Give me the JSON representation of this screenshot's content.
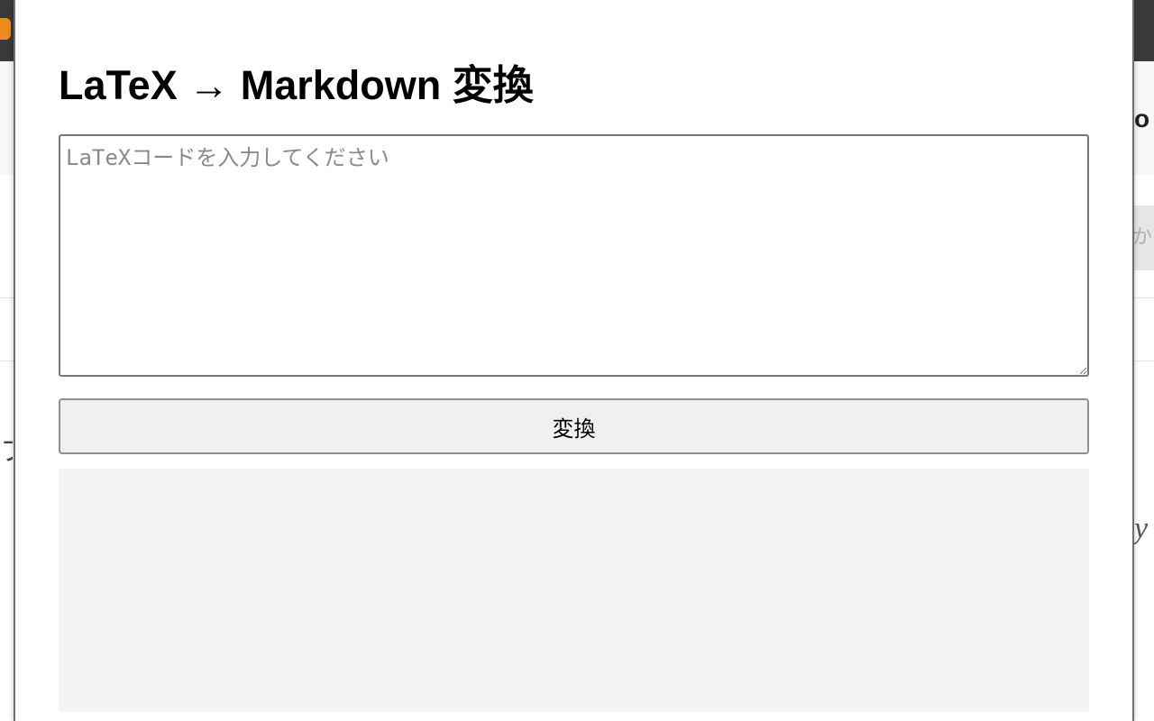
{
  "popup": {
    "title": "LaTeX → Markdown 変換",
    "input": {
      "value": "",
      "placeholder": "LaTeXコードを入力してください"
    },
    "convert_label": "変換",
    "output": ""
  },
  "background": {
    "right_fragment": "o",
    "left_glyph": "フ",
    "right_glyph": "y",
    "right_box_fragment": "か"
  },
  "colors": {
    "topbar": "#3a3a3a",
    "accent_orange": "#f08a1c",
    "output_bg": "#f4f4f4",
    "button_bg": "#f0f0f0"
  }
}
